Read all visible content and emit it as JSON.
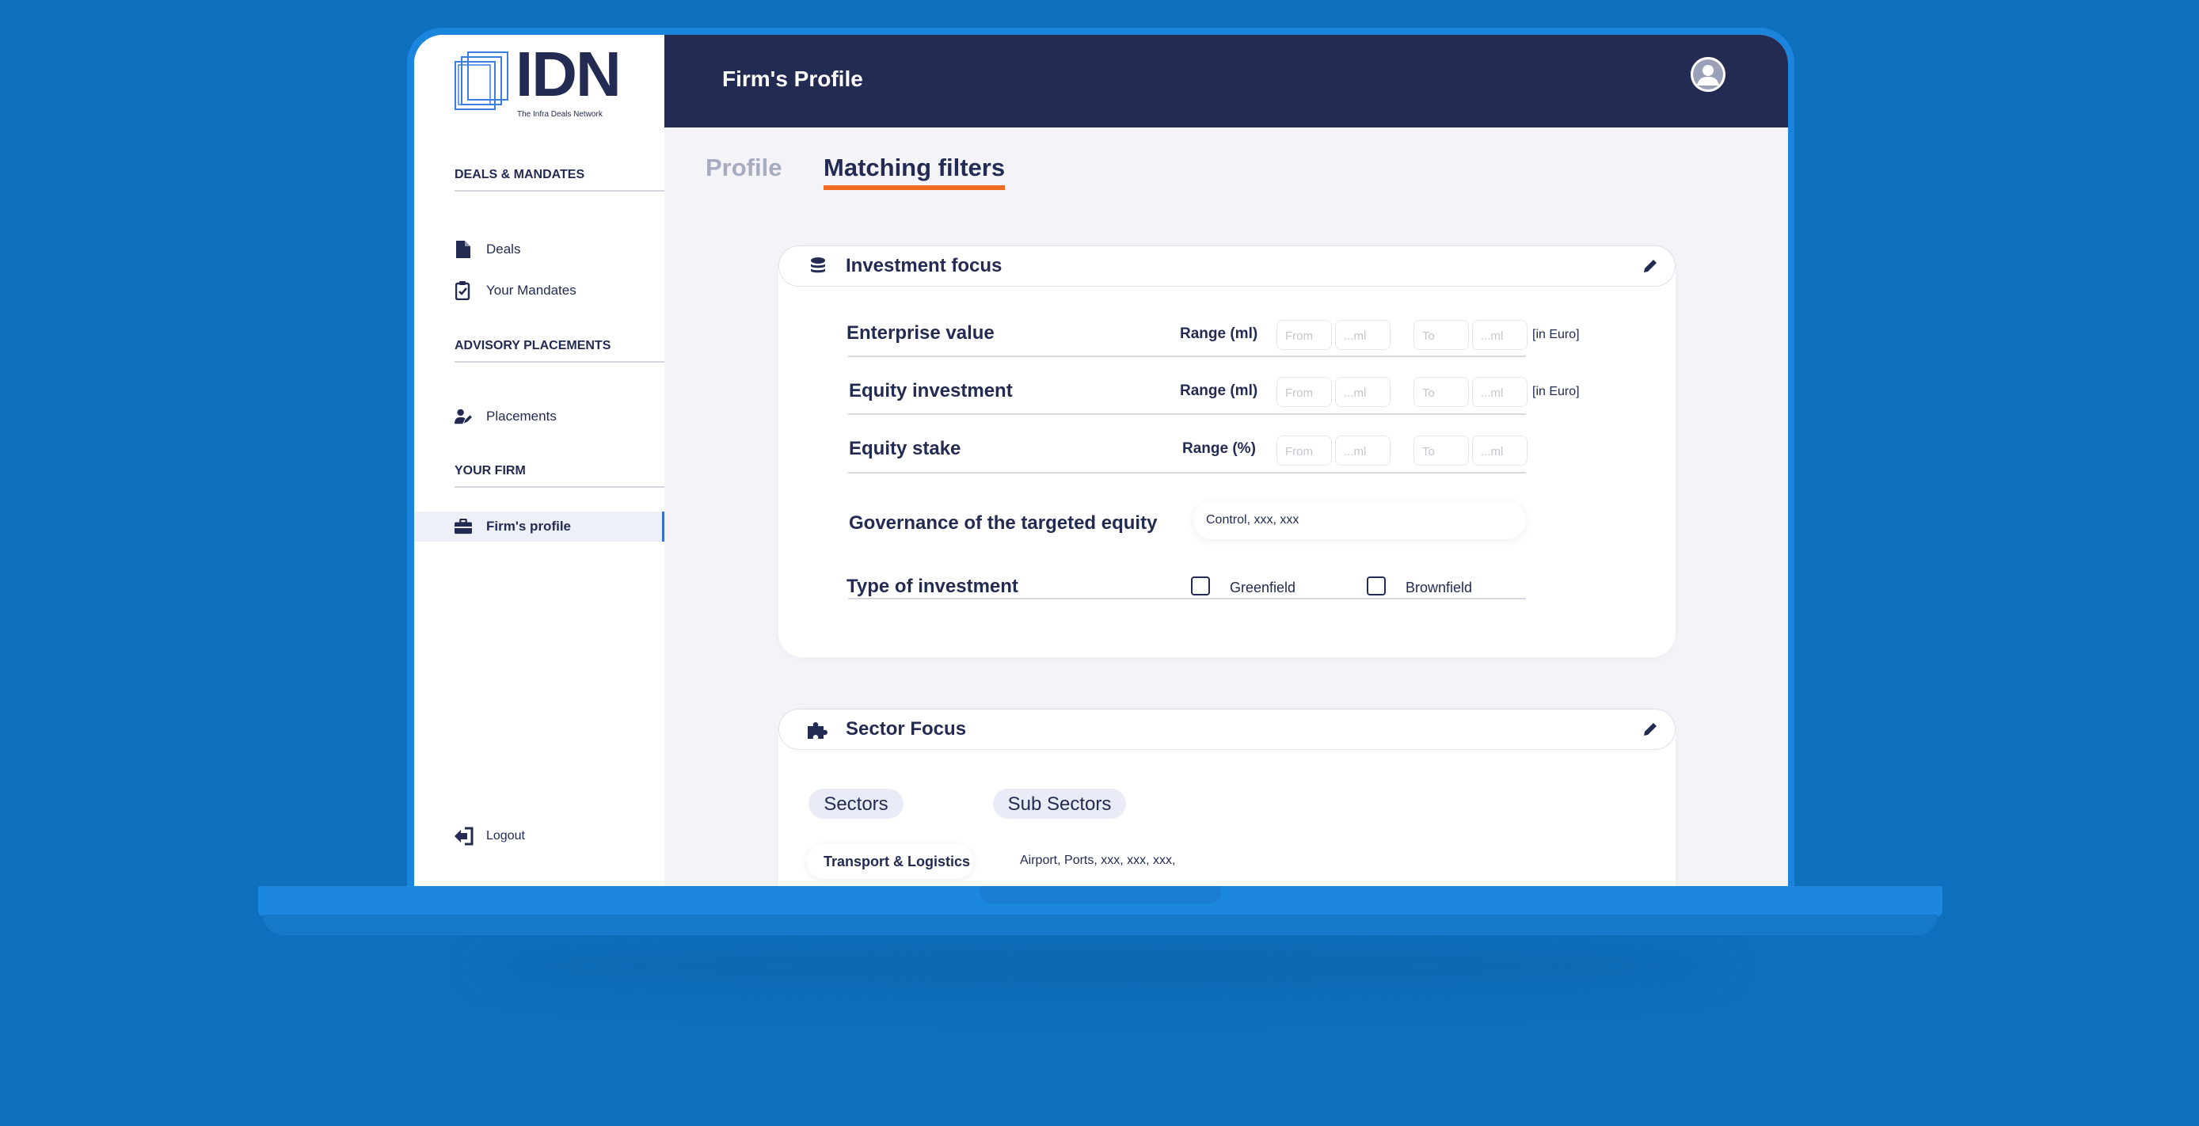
{
  "brand": {
    "logo_text": "IDN",
    "tagline": "The Infra Deals Network"
  },
  "header": {
    "title": "Firm's Profile"
  },
  "sidebar": {
    "sections": [
      {
        "title": "DEALS & MANDATES",
        "items": [
          {
            "label": "Deals",
            "icon": "document-icon"
          },
          {
            "label": "Your Mandates",
            "icon": "clipboard-check-icon"
          }
        ]
      },
      {
        "title": "ADVISORY PLACEMENTS",
        "items": [
          {
            "label": "Placements",
            "icon": "user-edit-icon"
          }
        ]
      },
      {
        "title": "YOUR FIRM",
        "items": [
          {
            "label": "Firm's profile",
            "icon": "briefcase-icon",
            "active": true
          }
        ]
      }
    ],
    "logout_label": "Logout"
  },
  "tabs": [
    {
      "label": "Profile",
      "active": false
    },
    {
      "label": "Matching filters",
      "active": true
    }
  ],
  "investment_focus": {
    "title": "Investment focus",
    "rows": [
      {
        "label": "Enterprise value",
        "range_label": "Range (ml)",
        "from_placeholder": "From",
        "from_unit_placeholder": "...ml",
        "to_placeholder": "To",
        "to_unit_placeholder": "...ml",
        "unit": "[in Euro]"
      },
      {
        "label": "Equity investment",
        "range_label": "Range (ml)",
        "from_placeholder": "From",
        "from_unit_placeholder": "...ml",
        "to_placeholder": "To",
        "to_unit_placeholder": "...ml",
        "unit": "[in Euro]"
      },
      {
        "label": "Equity stake",
        "range_label": "Range (%)",
        "from_placeholder": "From",
        "from_unit_placeholder": "...ml",
        "to_placeholder": "To",
        "to_unit_placeholder": "...ml"
      }
    ],
    "governance": {
      "label": "Governance of the targeted equity",
      "value": "Control, xxx, xxx"
    },
    "investment_type": {
      "label": "Type of investment",
      "options": [
        {
          "label": "Greenfield",
          "checked": false
        },
        {
          "label": "Brownfield",
          "checked": false
        }
      ]
    }
  },
  "sector_focus": {
    "title": "Sector Focus",
    "sectors_label": "Sectors",
    "sub_sectors_label": "Sub Sectors",
    "entries": [
      {
        "sector": "Transport & Logistics",
        "sub_sectors": "Airport, Ports, xxx, xxx, xxx,"
      }
    ]
  },
  "colors": {
    "navy": "#232b52",
    "accent": "#f36b21",
    "background": "#0e6fbc",
    "active_border": "#3a6fd8"
  }
}
